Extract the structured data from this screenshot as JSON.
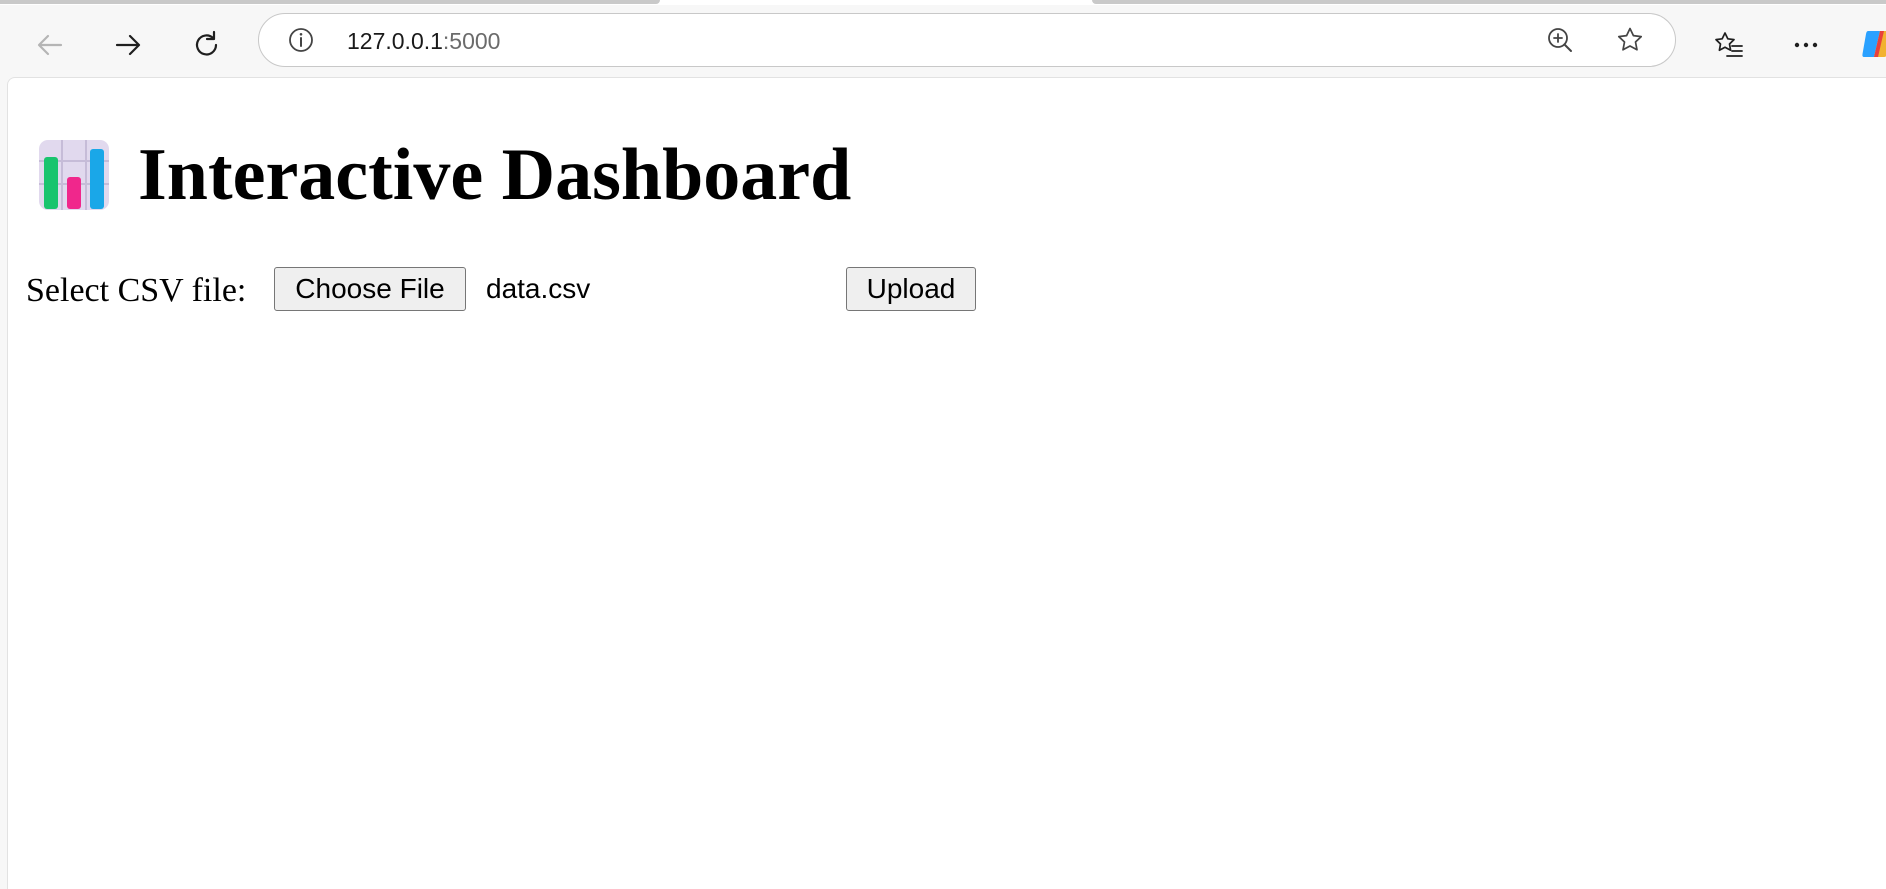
{
  "browser": {
    "url_host": "127.0.0.1",
    "url_port": ":5000",
    "icons": {
      "back": "back-arrow-icon",
      "forward": "forward-arrow-icon",
      "reload": "reload-icon",
      "info": "info-icon",
      "zoom": "zoom-in-icon",
      "favorite": "star-icon",
      "favorites_list": "favorites-icon",
      "more": "more-icon",
      "copilot": "copilot-icon"
    }
  },
  "page": {
    "title": "Interactive Dashboard",
    "title_icon": "bar-chart-icon",
    "form": {
      "label": "Select CSV file:",
      "choose_button": "Choose File",
      "selected_file": "data.csv",
      "upload_button": "Upload"
    }
  }
}
